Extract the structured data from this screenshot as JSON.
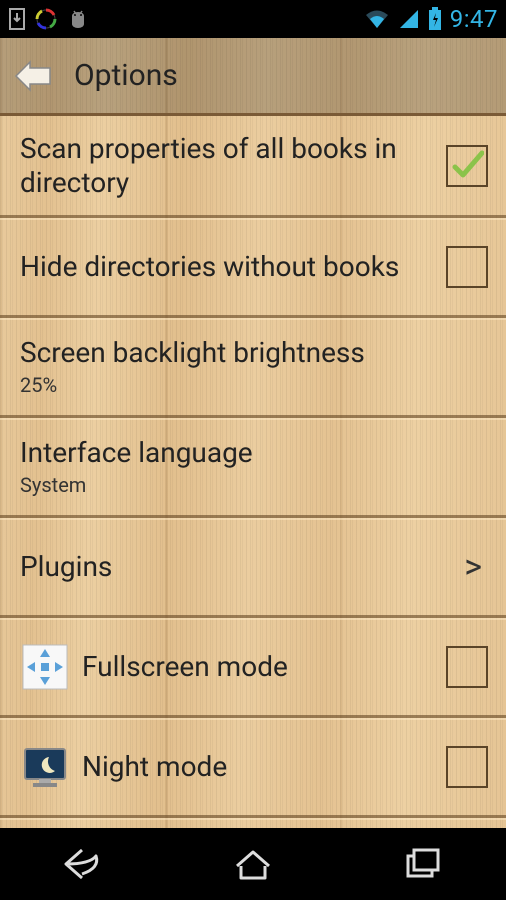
{
  "status": {
    "time": "9:47"
  },
  "header": {
    "title": "Options"
  },
  "options": {
    "scan_props": {
      "label": "Scan properties of all books in directory",
      "checked": true
    },
    "hide_dirs": {
      "label": "Hide directories without books",
      "checked": false
    },
    "brightness": {
      "label": "Screen backlight brightness",
      "value": "25%"
    },
    "language": {
      "label": "Interface language",
      "value": "System"
    },
    "plugins": {
      "label": "Plugins"
    },
    "fullscreen": {
      "label": "Fullscreen mode",
      "checked": false
    },
    "night": {
      "label": "Night mode",
      "checked": false
    }
  }
}
